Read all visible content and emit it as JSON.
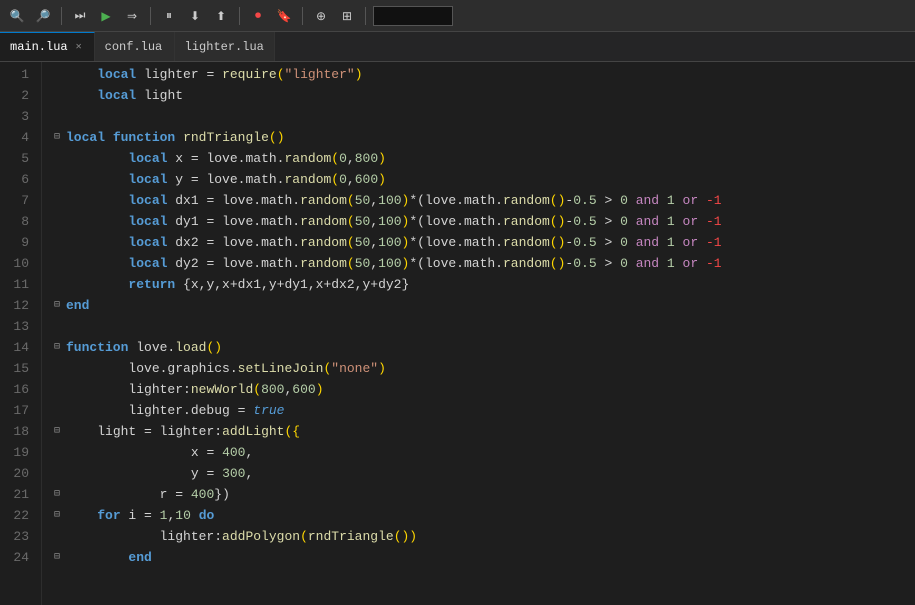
{
  "toolbar": {
    "buttons": [
      {
        "name": "search-btn",
        "icon": "🔍"
      },
      {
        "name": "search2-btn",
        "icon": "🔎"
      },
      {
        "name": "run-btn",
        "icon": "▶▶"
      },
      {
        "name": "play-btn",
        "icon": "▶"
      },
      {
        "name": "step-over-btn",
        "icon": "⇥"
      },
      {
        "name": "pause-btn",
        "icon": "⏸"
      },
      {
        "name": "step-into-btn",
        "icon": "⤵"
      },
      {
        "name": "step-out-btn",
        "icon": "⤴"
      },
      {
        "name": "record-btn",
        "icon": "⏺"
      },
      {
        "name": "bookmark-btn",
        "icon": "🔖"
      },
      {
        "name": "tool1-btn",
        "icon": "⊕"
      },
      {
        "name": "tool2-btn",
        "icon": "⊞"
      }
    ],
    "search_value": ""
  },
  "tabs": [
    {
      "label": "main.lua",
      "active": true,
      "closable": true
    },
    {
      "label": "conf.lua",
      "active": false,
      "closable": false
    },
    {
      "label": "lighter.lua",
      "active": false,
      "closable": false
    }
  ],
  "lines": [
    {
      "num": 1,
      "fold": "",
      "indent": 1,
      "tokens": [
        {
          "t": "kw-local",
          "v": "local"
        },
        {
          "t": "plain",
          "v": " lighter "
        },
        {
          "t": "operator",
          "v": "="
        },
        {
          "t": "plain",
          "v": " "
        },
        {
          "t": "fn-name",
          "v": "require"
        },
        {
          "t": "paren",
          "v": "("
        },
        {
          "t": "string",
          "v": "\"lighter\""
        },
        {
          "t": "paren",
          "v": ")"
        }
      ]
    },
    {
      "num": 2,
      "fold": "",
      "indent": 1,
      "tokens": [
        {
          "t": "kw-local",
          "v": "local"
        },
        {
          "t": "plain",
          "v": " light"
        }
      ]
    },
    {
      "num": 3,
      "fold": "",
      "indent": 0,
      "tokens": []
    },
    {
      "num": 4,
      "fold": "⊟",
      "indent": 0,
      "tokens": [
        {
          "t": "kw-local",
          "v": "local"
        },
        {
          "t": "plain",
          "v": " "
        },
        {
          "t": "kw-function",
          "v": "function"
        },
        {
          "t": "plain",
          "v": " "
        },
        {
          "t": "fn-name",
          "v": "rndTriangle"
        },
        {
          "t": "paren",
          "v": "()"
        }
      ]
    },
    {
      "num": 5,
      "fold": "",
      "indent": 2,
      "tokens": [
        {
          "t": "kw-local",
          "v": "local"
        },
        {
          "t": "plain",
          "v": " x "
        },
        {
          "t": "operator",
          "v": "="
        },
        {
          "t": "plain",
          "v": " love.math."
        },
        {
          "t": "fn-name",
          "v": "random"
        },
        {
          "t": "paren",
          "v": "("
        },
        {
          "t": "number",
          "v": "0"
        },
        {
          "t": "plain",
          "v": ","
        },
        {
          "t": "number",
          "v": "800"
        },
        {
          "t": "paren",
          "v": ")"
        }
      ]
    },
    {
      "num": 6,
      "fold": "",
      "indent": 2,
      "tokens": [
        {
          "t": "kw-local",
          "v": "local"
        },
        {
          "t": "plain",
          "v": " y "
        },
        {
          "t": "operator",
          "v": "="
        },
        {
          "t": "plain",
          "v": " love.math."
        },
        {
          "t": "fn-name",
          "v": "random"
        },
        {
          "t": "paren",
          "v": "("
        },
        {
          "t": "number",
          "v": "0"
        },
        {
          "t": "plain",
          "v": ","
        },
        {
          "t": "number",
          "v": "600"
        },
        {
          "t": "paren",
          "v": ")"
        }
      ]
    },
    {
      "num": 7,
      "fold": "",
      "indent": 2,
      "tokens": [
        {
          "t": "kw-local",
          "v": "local"
        },
        {
          "t": "plain",
          "v": " dx1 "
        },
        {
          "t": "operator",
          "v": "="
        },
        {
          "t": "plain",
          "v": " love.math."
        },
        {
          "t": "fn-name",
          "v": "random"
        },
        {
          "t": "paren",
          "v": "("
        },
        {
          "t": "number",
          "v": "50"
        },
        {
          "t": "plain",
          "v": ","
        },
        {
          "t": "number",
          "v": "100"
        },
        {
          "t": "paren",
          "v": ")"
        },
        {
          "t": "operator",
          "v": "*("
        },
        {
          "t": "plain",
          "v": "love.math."
        },
        {
          "t": "fn-name",
          "v": "random"
        },
        {
          "t": "paren",
          "v": "()"
        },
        {
          "t": "operator",
          "v": "-"
        },
        {
          "t": "number",
          "v": "0.5"
        },
        {
          "t": "plain",
          "v": " "
        },
        {
          "t": "operator",
          "v": ">"
        },
        {
          "t": "plain",
          "v": " "
        },
        {
          "t": "number",
          "v": "0"
        },
        {
          "t": "plain",
          "v": " "
        },
        {
          "t": "bool-op",
          "v": "and"
        },
        {
          "t": "plain",
          "v": " "
        },
        {
          "t": "number",
          "v": "1"
        },
        {
          "t": "plain",
          "v": " "
        },
        {
          "t": "bool-op",
          "v": "or"
        },
        {
          "t": "plain",
          "v": " "
        },
        {
          "t": "negative",
          "v": "-1"
        }
      ]
    },
    {
      "num": 8,
      "fold": "",
      "indent": 2,
      "tokens": [
        {
          "t": "kw-local",
          "v": "local"
        },
        {
          "t": "plain",
          "v": " dy1 "
        },
        {
          "t": "operator",
          "v": "="
        },
        {
          "t": "plain",
          "v": " love.math."
        },
        {
          "t": "fn-name",
          "v": "random"
        },
        {
          "t": "paren",
          "v": "("
        },
        {
          "t": "number",
          "v": "50"
        },
        {
          "t": "plain",
          "v": ","
        },
        {
          "t": "number",
          "v": "100"
        },
        {
          "t": "paren",
          "v": ")"
        },
        {
          "t": "operator",
          "v": "*("
        },
        {
          "t": "plain",
          "v": "love.math."
        },
        {
          "t": "fn-name",
          "v": "random"
        },
        {
          "t": "paren",
          "v": "()"
        },
        {
          "t": "operator",
          "v": "-"
        },
        {
          "t": "number",
          "v": "0.5"
        },
        {
          "t": "plain",
          "v": " "
        },
        {
          "t": "operator",
          "v": ">"
        },
        {
          "t": "plain",
          "v": " "
        },
        {
          "t": "number",
          "v": "0"
        },
        {
          "t": "plain",
          "v": " "
        },
        {
          "t": "bool-op",
          "v": "and"
        },
        {
          "t": "plain",
          "v": " "
        },
        {
          "t": "number",
          "v": "1"
        },
        {
          "t": "plain",
          "v": " "
        },
        {
          "t": "bool-op",
          "v": "or"
        },
        {
          "t": "plain",
          "v": " "
        },
        {
          "t": "negative",
          "v": "-1"
        }
      ]
    },
    {
      "num": 9,
      "fold": "",
      "indent": 2,
      "tokens": [
        {
          "t": "kw-local",
          "v": "local"
        },
        {
          "t": "plain",
          "v": " dx2 "
        },
        {
          "t": "operator",
          "v": "="
        },
        {
          "t": "plain",
          "v": " love.math."
        },
        {
          "t": "fn-name",
          "v": "random"
        },
        {
          "t": "paren",
          "v": "("
        },
        {
          "t": "number",
          "v": "50"
        },
        {
          "t": "plain",
          "v": ","
        },
        {
          "t": "number",
          "v": "100"
        },
        {
          "t": "paren",
          "v": ")"
        },
        {
          "t": "operator",
          "v": "*("
        },
        {
          "t": "plain",
          "v": "love.math."
        },
        {
          "t": "fn-name",
          "v": "random"
        },
        {
          "t": "paren",
          "v": "()"
        },
        {
          "t": "operator",
          "v": "-"
        },
        {
          "t": "number",
          "v": "0.5"
        },
        {
          "t": "plain",
          "v": " "
        },
        {
          "t": "operator",
          "v": ">"
        },
        {
          "t": "plain",
          "v": " "
        },
        {
          "t": "number",
          "v": "0"
        },
        {
          "t": "plain",
          "v": " "
        },
        {
          "t": "bool-op",
          "v": "and"
        },
        {
          "t": "plain",
          "v": " "
        },
        {
          "t": "number",
          "v": "1"
        },
        {
          "t": "plain",
          "v": " "
        },
        {
          "t": "bool-op",
          "v": "or"
        },
        {
          "t": "plain",
          "v": " "
        },
        {
          "t": "negative",
          "v": "-1"
        }
      ]
    },
    {
      "num": 10,
      "fold": "",
      "indent": 2,
      "tokens": [
        {
          "t": "kw-local",
          "v": "local"
        },
        {
          "t": "plain",
          "v": " dy2 "
        },
        {
          "t": "operator",
          "v": "="
        },
        {
          "t": "plain",
          "v": " love.math."
        },
        {
          "t": "fn-name",
          "v": "random"
        },
        {
          "t": "paren",
          "v": "("
        },
        {
          "t": "number",
          "v": "50"
        },
        {
          "t": "plain",
          "v": ","
        },
        {
          "t": "number",
          "v": "100"
        },
        {
          "t": "paren",
          "v": ")"
        },
        {
          "t": "operator",
          "v": "*("
        },
        {
          "t": "plain",
          "v": "love.math."
        },
        {
          "t": "fn-name",
          "v": "random"
        },
        {
          "t": "paren",
          "v": "()"
        },
        {
          "t": "operator",
          "v": "-"
        },
        {
          "t": "number",
          "v": "0.5"
        },
        {
          "t": "plain",
          "v": " "
        },
        {
          "t": "operator",
          "v": ">"
        },
        {
          "t": "plain",
          "v": " "
        },
        {
          "t": "number",
          "v": "0"
        },
        {
          "t": "plain",
          "v": " "
        },
        {
          "t": "bool-op",
          "v": "and"
        },
        {
          "t": "plain",
          "v": " "
        },
        {
          "t": "number",
          "v": "1"
        },
        {
          "t": "plain",
          "v": " "
        },
        {
          "t": "bool-op",
          "v": "or"
        },
        {
          "t": "plain",
          "v": " "
        },
        {
          "t": "negative",
          "v": "-1"
        }
      ]
    },
    {
      "num": 11,
      "fold": "",
      "indent": 2,
      "tokens": [
        {
          "t": "kw-return",
          "v": "return"
        },
        {
          "t": "plain",
          "v": " {x,y,x+dx1,y+dy1,x+dx2,y+dy2}"
        }
      ]
    },
    {
      "num": 12,
      "fold": "⊟",
      "indent": 0,
      "tokens": [
        {
          "t": "kw-end",
          "v": "end"
        }
      ]
    },
    {
      "num": 13,
      "fold": "",
      "indent": 0,
      "tokens": []
    },
    {
      "num": 14,
      "fold": "⊟",
      "indent": 0,
      "tokens": [
        {
          "t": "kw-function",
          "v": "function"
        },
        {
          "t": "plain",
          "v": " love."
        },
        {
          "t": "fn-name",
          "v": "load"
        },
        {
          "t": "paren",
          "v": "()"
        }
      ]
    },
    {
      "num": 15,
      "fold": "",
      "indent": 2,
      "tokens": [
        {
          "t": "plain",
          "v": "love.graphics."
        },
        {
          "t": "fn-name",
          "v": "setLineJoin"
        },
        {
          "t": "paren",
          "v": "("
        },
        {
          "t": "string",
          "v": "\"none\""
        },
        {
          "t": "paren",
          "v": ")"
        }
      ]
    },
    {
      "num": 16,
      "fold": "",
      "indent": 2,
      "tokens": [
        {
          "t": "plain",
          "v": "lighter:"
        },
        {
          "t": "fn-name",
          "v": "newWorld"
        },
        {
          "t": "paren",
          "v": "("
        },
        {
          "t": "number",
          "v": "800"
        },
        {
          "t": "plain",
          "v": ","
        },
        {
          "t": "number",
          "v": "600"
        },
        {
          "t": "paren",
          "v": ")"
        }
      ]
    },
    {
      "num": 17,
      "fold": "",
      "indent": 2,
      "tokens": [
        {
          "t": "plain",
          "v": "lighter.debug "
        },
        {
          "t": "operator",
          "v": "="
        },
        {
          "t": "plain",
          "v": " "
        },
        {
          "t": "kw-true",
          "v": "true"
        }
      ]
    },
    {
      "num": 18,
      "fold": "⊟",
      "indent": 1,
      "tokens": [
        {
          "t": "plain",
          "v": "light "
        },
        {
          "t": "operator",
          "v": "="
        },
        {
          "t": "plain",
          "v": " lighter:"
        },
        {
          "t": "fn-name",
          "v": "addLight"
        },
        {
          "t": "paren",
          "v": "({"
        }
      ]
    },
    {
      "num": 19,
      "fold": "",
      "indent": 4,
      "tokens": [
        {
          "t": "plain",
          "v": "x "
        },
        {
          "t": "operator",
          "v": "="
        },
        {
          "t": "plain",
          "v": " "
        },
        {
          "t": "number",
          "v": "400"
        },
        {
          "t": "plain",
          "v": ","
        }
      ]
    },
    {
      "num": 20,
      "fold": "",
      "indent": 4,
      "tokens": [
        {
          "t": "plain",
          "v": "y "
        },
        {
          "t": "operator",
          "v": "="
        },
        {
          "t": "plain",
          "v": " "
        },
        {
          "t": "number",
          "v": "300"
        },
        {
          "t": "plain",
          "v": ","
        }
      ]
    },
    {
      "num": 21,
      "fold": "⊟",
      "indent": 3,
      "tokens": [
        {
          "t": "plain",
          "v": "r "
        },
        {
          "t": "operator",
          "v": "="
        },
        {
          "t": "plain",
          "v": " "
        },
        {
          "t": "number",
          "v": "400"
        },
        {
          "t": "plain",
          "v": "})"
        }
      ]
    },
    {
      "num": 22,
      "fold": "⊟",
      "indent": 1,
      "tokens": [
        {
          "t": "kw-for",
          "v": "for"
        },
        {
          "t": "plain",
          "v": " i "
        },
        {
          "t": "operator",
          "v": "="
        },
        {
          "t": "plain",
          "v": " "
        },
        {
          "t": "number",
          "v": "1"
        },
        {
          "t": "plain",
          "v": ","
        },
        {
          "t": "number",
          "v": "10"
        },
        {
          "t": "plain",
          "v": " "
        },
        {
          "t": "kw-do",
          "v": "do"
        }
      ]
    },
    {
      "num": 23,
      "fold": "",
      "indent": 3,
      "tokens": [
        {
          "t": "plain",
          "v": "lighter:"
        },
        {
          "t": "fn-name",
          "v": "addPolygon"
        },
        {
          "t": "paren",
          "v": "("
        },
        {
          "t": "fn-name",
          "v": "rndTriangle"
        },
        {
          "t": "paren",
          "v": "())"
        }
      ]
    },
    {
      "num": 24,
      "fold": "⊟",
      "indent": 2,
      "tokens": [
        {
          "t": "kw-end",
          "v": "end"
        }
      ]
    }
  ]
}
